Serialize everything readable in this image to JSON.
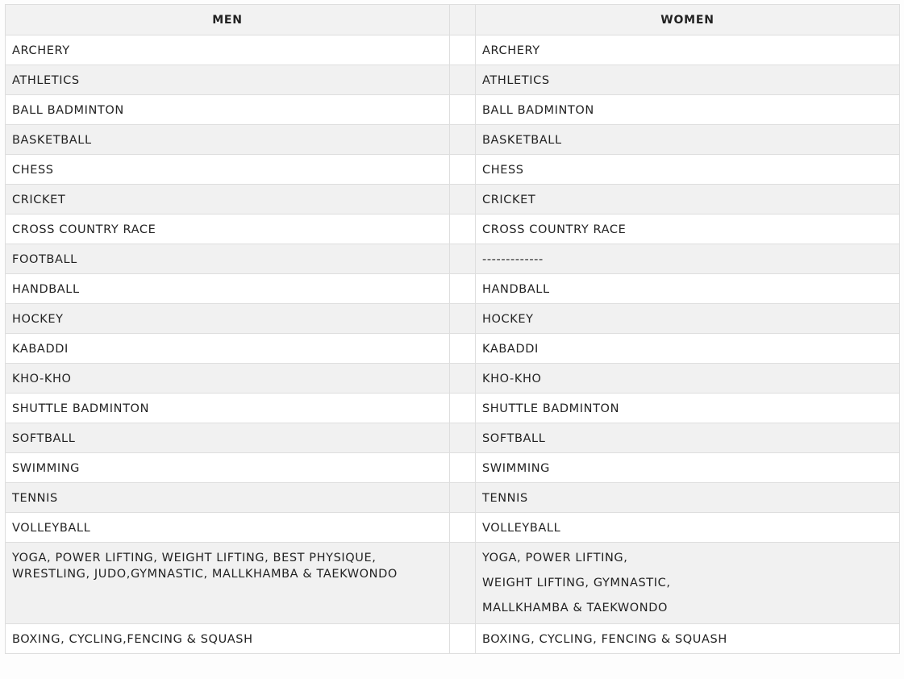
{
  "table": {
    "headers": {
      "men": "MEN",
      "gap": "",
      "women": "WOMEN"
    },
    "rows": [
      {
        "men": [
          "ARCHERY"
        ],
        "women": [
          "ARCHERY"
        ]
      },
      {
        "men": [
          "ATHLETICS"
        ],
        "women": [
          "ATHLETICS"
        ]
      },
      {
        "men": [
          "BALL BADMINTON"
        ],
        "women": [
          "BALL BADMINTON"
        ]
      },
      {
        "men": [
          "BASKETBALL"
        ],
        "women": [
          "BASKETBALL"
        ]
      },
      {
        "men": [
          "CHESS"
        ],
        "women": [
          "CHESS"
        ]
      },
      {
        "men": [
          "CRICKET"
        ],
        "women": [
          "CRICKET"
        ]
      },
      {
        "men": [
          "CROSS COUNTRY RACE"
        ],
        "women": [
          "CROSS COUNTRY RACE"
        ]
      },
      {
        "men": [
          "FOOTBALL"
        ],
        "women": [
          "-------------"
        ]
      },
      {
        "men": [
          "HANDBALL"
        ],
        "women": [
          "HANDBALL"
        ]
      },
      {
        "men": [
          "HOCKEY"
        ],
        "women": [
          "HOCKEY"
        ]
      },
      {
        "men": [
          "KABADDI"
        ],
        "women": [
          "KABADDI"
        ]
      },
      {
        "men": [
          "KHO-KHO"
        ],
        "women": [
          "KHO-KHO"
        ]
      },
      {
        "men": [
          "SHUTTLE BADMINTON"
        ],
        "women": [
          "SHUTTLE BADMINTON"
        ]
      },
      {
        "men": [
          "SOFTBALL"
        ],
        "women": [
          "SOFTBALL"
        ]
      },
      {
        "men": [
          "SWIMMING"
        ],
        "women": [
          "SWIMMING"
        ]
      },
      {
        "men": [
          "TENNIS"
        ],
        "women": [
          "TENNIS"
        ]
      },
      {
        "men": [
          "VOLLEYBALL"
        ],
        "women": [
          "VOLLEYBALL"
        ]
      },
      {
        "men": [
          "YOGA, POWER LIFTING, WEIGHT LIFTING, BEST PHYSIQUE,",
          "WRESTLING, JUDO,GYMNASTIC, MALLKHAMBA & TAEKWONDO"
        ],
        "women": [
          "YOGA, POWER LIFTING,",
          "WEIGHT LIFTING, GYMNASTIC,",
          "MALLKHAMBA & TAEKWONDO"
        ]
      },
      {
        "men": [
          "BOXING, CYCLING,FENCING & SQUASH"
        ],
        "women": [
          "BOXING, CYCLING, FENCING & SQUASH"
        ]
      }
    ]
  }
}
